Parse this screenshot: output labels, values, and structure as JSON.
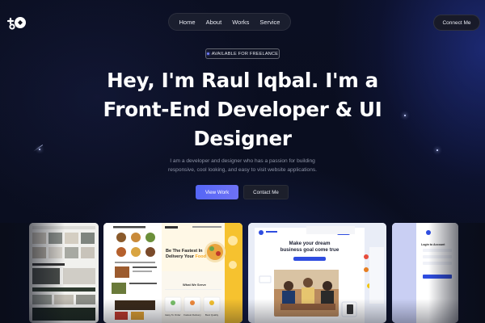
{
  "nav": {
    "links": [
      "Home",
      "About",
      "Works",
      "Service"
    ],
    "cta": "Connect Me"
  },
  "hero": {
    "badge": "AVAILABLE FOR FREELANCE",
    "headline_line1": "Hey, I'm Raul Iqbal. I'm a",
    "headline_line2": "Front-End Developer & UI",
    "headline_line3": "Designer",
    "description_line1": "I am a developer and designer who has a passion for building",
    "description_line2": "responsive, cool looking, and easy to visit website applications.",
    "primary_button": "View Work",
    "secondary_button": "Contact Me"
  },
  "showcase": {
    "food_title_line1": "Be The Fastest In",
    "food_title_line2": "Delivery Your",
    "food_highlight": "Food",
    "food_section": "What We Serve",
    "food_features": [
      "Easy To Order",
      "Fastest Delivery",
      "Best Quality"
    ],
    "business_title_line1": "Make your dream",
    "business_title_line2": "business goal come true",
    "login_title": "Login to Account"
  },
  "colors": {
    "accent": "#5b67f5",
    "background": "#0a0d1a",
    "food_yellow": "#f6c22f",
    "business_blue": "#2f4de0"
  }
}
